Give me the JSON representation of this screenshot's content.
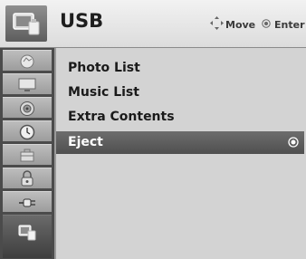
{
  "header": {
    "title": "USB",
    "icon": "usb-device-icon",
    "hints": {
      "move_label": "Move",
      "move_icon": "four-way-arrow-icon",
      "enter_label": "Enter",
      "enter_icon": "ok-circle-icon"
    }
  },
  "sidebar": {
    "items": [
      {
        "icon": "picture-setup-icon",
        "active": false
      },
      {
        "icon": "screen-icon",
        "active": false
      },
      {
        "icon": "audio-speaker-icon",
        "active": false
      },
      {
        "icon": "time-clock-icon",
        "active": false
      },
      {
        "icon": "option-briefcase-icon",
        "active": false
      },
      {
        "icon": "lock-icon",
        "active": false
      },
      {
        "icon": "input-plug-icon",
        "active": false
      },
      {
        "icon": "usb-icon",
        "active": true
      }
    ]
  },
  "menu": {
    "items": [
      {
        "label": "Photo List",
        "selected": false
      },
      {
        "label": "Music List",
        "selected": false
      },
      {
        "label": "Extra Contents",
        "selected": false
      },
      {
        "label": "Eject",
        "selected": true
      }
    ]
  },
  "colors": {
    "selection": "#5a5a5a",
    "menu_background": "#d3d3d3",
    "sidebar_background": "#4b4b4b"
  }
}
